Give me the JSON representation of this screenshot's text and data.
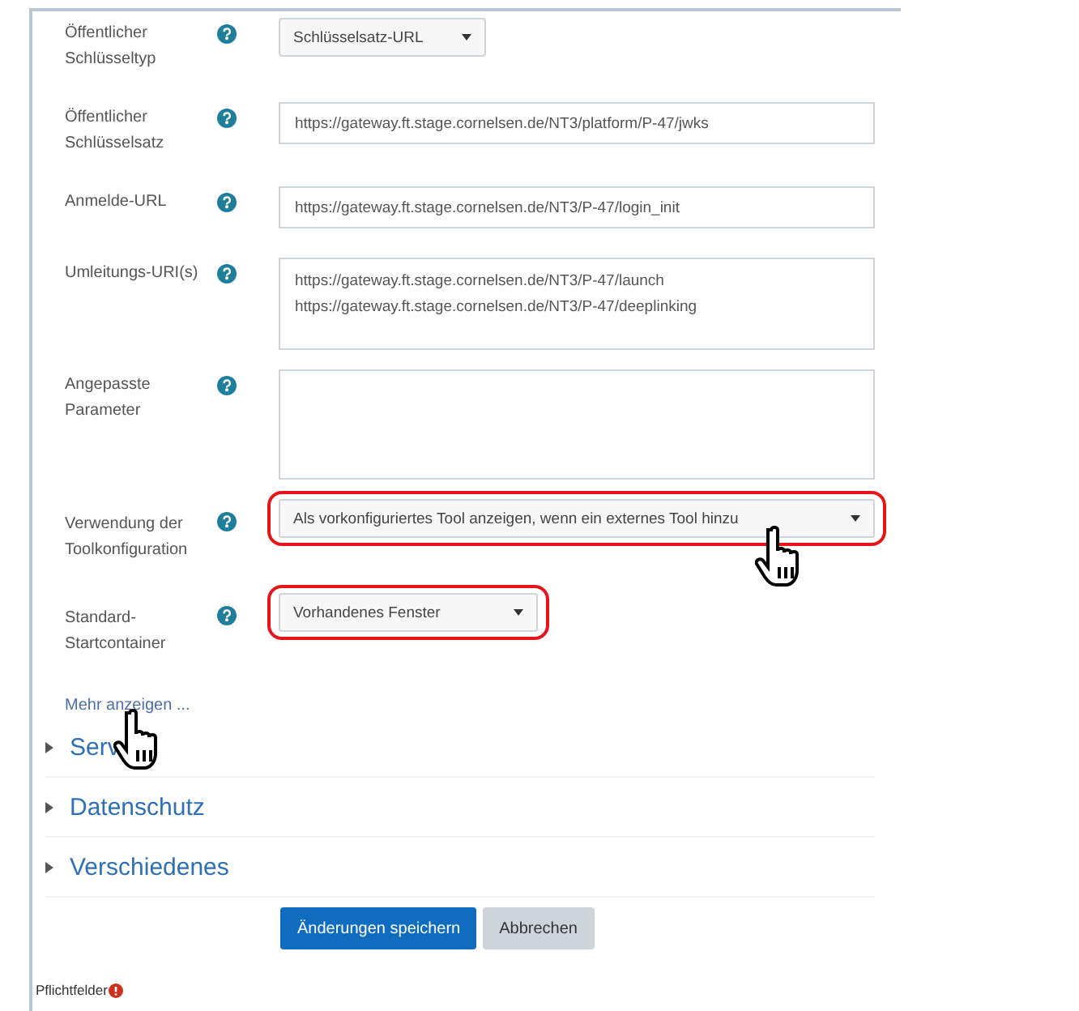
{
  "fields": [
    {
      "label": "Öffentlicher Schlüsseltyp",
      "kind": "select",
      "value": "Schlüsselsatz-URL",
      "highlighted": false
    },
    {
      "label": "Öffentlicher Schlüsselsatz",
      "kind": "input",
      "value": "https://gateway.ft.stage.cornelsen.de/NT3/platform/P-47/jwks"
    },
    {
      "label": "Anmelde-URL",
      "kind": "input",
      "value": "https://gateway.ft.stage.cornelsen.de/NT3/P-47/login_init"
    },
    {
      "label": "Umleitungs-URI(s)",
      "kind": "textarea",
      "lines": [
        "https://gateway.ft.stage.cornelsen.de/NT3/P-47/launch",
        "https://gateway.ft.stage.cornelsen.de/NT3/P-47/deeplinking"
      ]
    },
    {
      "label": "Angepasste Parameter",
      "kind": "textarea"
    },
    {
      "label": "Verwendung der Toolkonfiguration",
      "kind": "select",
      "value": "Als vorkonfiguriertes Tool anzeigen, wenn ein externes Tool hinzu",
      "highlighted": true,
      "wide": true,
      "cursor": true
    },
    {
      "label": "Standard-Startcontainer",
      "kind": "select",
      "value": "Vorhandenes Fenster",
      "highlighted": true
    }
  ],
  "more_link": "Mehr anzeigen ...",
  "sections": [
    {
      "title": "Serv",
      "expanded": false,
      "cursor": true
    },
    {
      "title": "Datenschutz",
      "expanded": false
    },
    {
      "title": "Verschiedenes",
      "expanded": false
    }
  ],
  "buttons": [
    {
      "label": "Änderungen speichern",
      "kind": "primary"
    },
    {
      "label": "Abbrechen",
      "kind": "secondary"
    }
  ],
  "required_note": "Pflichtfelder"
}
